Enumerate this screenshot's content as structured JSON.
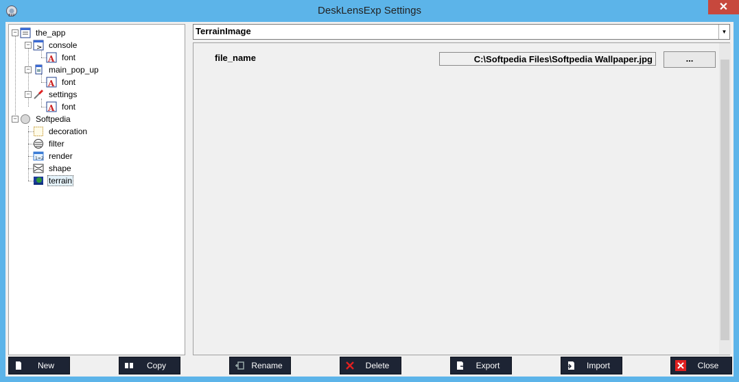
{
  "window": {
    "title": "DeskLensExp Settings",
    "close_glyph": "✕"
  },
  "tree": {
    "nodes": [
      {
        "label": "the_app",
        "icon": "window-icon",
        "toggle": "−"
      },
      {
        "label": "console",
        "icon": "console-icon",
        "toggle": "−"
      },
      {
        "label": "font",
        "icon": "font-icon"
      },
      {
        "label": "main_pop_up",
        "icon": "popup-icon",
        "toggle": "−"
      },
      {
        "label": "font",
        "icon": "font-icon"
      },
      {
        "label": "settings",
        "icon": "settings-icon",
        "toggle": "−"
      },
      {
        "label": "font",
        "icon": "font-icon"
      },
      {
        "label": "Softpedia",
        "icon": "circle-icon",
        "toggle": "−"
      },
      {
        "label": "decoration",
        "icon": "decoration-icon"
      },
      {
        "label": "filter",
        "icon": "filter-icon"
      },
      {
        "label": "render",
        "icon": "render-icon"
      },
      {
        "label": "shape",
        "icon": "shape-icon"
      },
      {
        "label": "terrain",
        "icon": "terrain-icon",
        "selected": true
      }
    ]
  },
  "section_selector": {
    "value": "TerrainImage",
    "arrow": "▼"
  },
  "properties": {
    "file_name_label": "file_name",
    "file_name_value": "C:\\Softpedia Files\\Softpedia Wallpaper.jpg",
    "browse_label": "..."
  },
  "buttons": {
    "new": "New",
    "copy": "Copy",
    "rename": "Rename",
    "delete": "Delete",
    "export": "Export",
    "import": "Import",
    "close": "Close"
  },
  "colors": {
    "title_bar": "#5cb4e9",
    "close_button": "#c7483d",
    "button_bar": "#1d2434",
    "delete_icon": "#e02020",
    "close_icon": "#e02020"
  }
}
